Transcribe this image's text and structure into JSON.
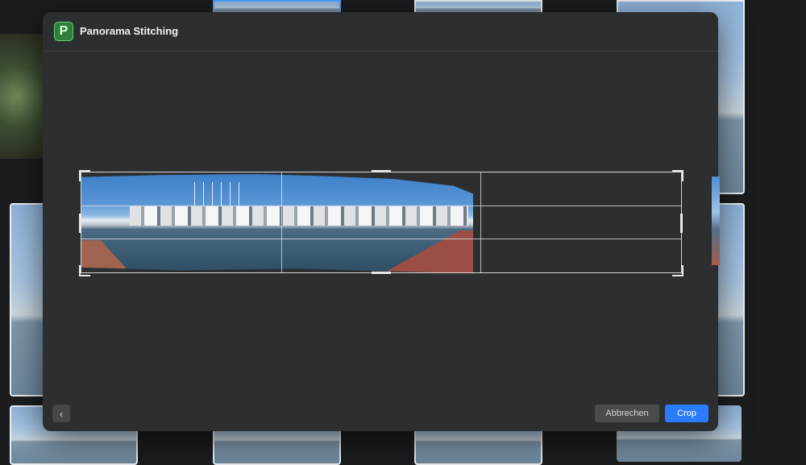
{
  "dialog": {
    "title": "Panorama Stitching",
    "app_icon_letter": "P"
  },
  "footer": {
    "back_label": "‹",
    "cancel_label": "Abbrechen",
    "crop_label": "Crop"
  },
  "icons": {
    "app": "panorama-app-icon",
    "back": "chevron-left-icon"
  },
  "colors": {
    "accent": "#2a7cff",
    "selected_thumb": "#4aa3ff",
    "app_icon": "#2f7d3a"
  }
}
